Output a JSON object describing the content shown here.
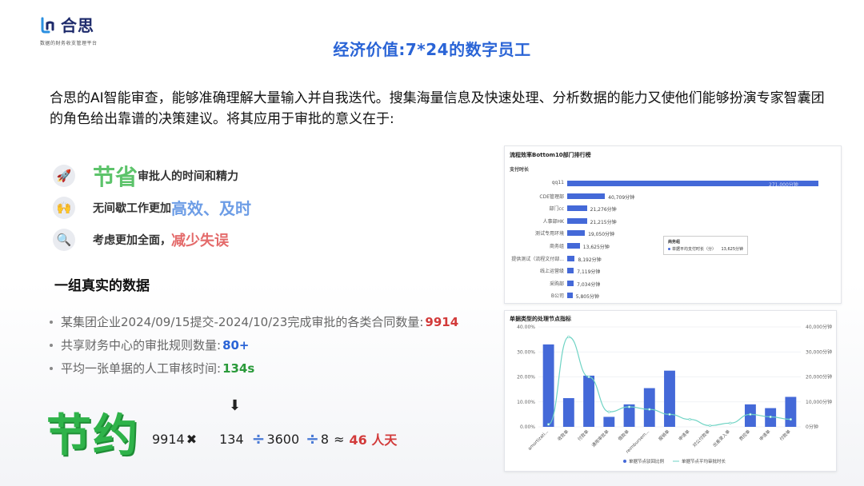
{
  "logo": {
    "name": "合思",
    "tagline": "数据的财务收支管理平台"
  },
  "title": "经济价值:7*24的数字员工",
  "intro": "合思的AI智能审查，能够准确理解大量输入并自我迭代。搜集海量信息及快速处理、分析数据的能力又使他们能够扮演专家智囊团的角色给出靠谱的决策建议。将其应用于审批的意义在于:",
  "points": [
    {
      "icon": "rocket-icon",
      "glyph": "🚀",
      "emph": "节省",
      "text": "审批人的时间和精力"
    },
    {
      "icon": "hands-icon",
      "glyph": "🙌",
      "text": "无间歇工作更加",
      "emph": "高效、及时"
    },
    {
      "icon": "magnifier-icon",
      "glyph": "🔍",
      "text": "考虑更加全面，",
      "emph": "减少失误"
    }
  ],
  "data_heading": "一组真实的数据",
  "facts": [
    {
      "text": "某集团企业2024/09/15提交-2024/10/23完成审批的各类合同数量:",
      "value": "9914"
    },
    {
      "text": "共享财务中心的审批规则数量:",
      "value": "80+"
    },
    {
      "text": "平均一张单据的人工审核时间:",
      "value": "134s"
    }
  ],
  "save_word": "节约",
  "formula": {
    "a": "9914",
    "times": "✖",
    "b": "134",
    "div1": "÷",
    "c": "3600",
    "div2": "÷",
    "d": "8",
    "approx": "≈",
    "result": "46 人天"
  },
  "arrow": "⬇",
  "colors": {
    "accent": "#2a64d6",
    "bar": "#4469d8",
    "green": "#2fb34a",
    "red": "#d23a3a"
  },
  "chart_data": [
    {
      "type": "bar",
      "title": "流程效率Bottom10部门排行榜",
      "subtitle": "支付时长",
      "categories": [
        "qq11",
        "CDE管理部",
        "部门cc",
        "人事部HK",
        "测试专用环境",
        "商务组",
        "提供测试（流程文付部...",
        "线上运营级",
        "采购部",
        "B公司"
      ],
      "values": [
        271000,
        40709,
        21276,
        21215,
        19050,
        13625,
        8192,
        7119,
        7034,
        5805
      ],
      "value_labels": [
        "271,000分钟",
        "40,709分钟",
        "21,276分钟",
        "21,215分钟",
        "19,050分钟",
        "13,625分钟",
        "8,192分钟",
        "7,119分钟",
        "7,034分钟",
        "5,805分钟"
      ],
      "tooltip": {
        "title": "商务组",
        "label": "单据平均支付时长（分）",
        "value": "13,625分钟"
      }
    },
    {
      "type": "bar",
      "title": "单据类型的处理节点指标",
      "categories": [
        "amortizati...",
        "收款单",
        "付款单",
        "通用审批单",
        "借款单",
        "reimbursem...",
        "报销单",
        "申请单",
        "对公付款单",
        "出差录入单",
        "费控单",
        "申请单",
        "付款单"
      ],
      "series": [
        {
          "name": "单据节点驳回比例",
          "values": [
            33,
            11.5,
            20.5,
            4,
            9,
            15.5,
            22.5,
            0,
            0,
            0,
            9,
            7.5,
            12
          ]
        },
        {
          "name": "单据节点平均审批时长",
          "values": [
            1000,
            36000,
            20000,
            6000,
            8000,
            7000,
            5000,
            3000,
            500,
            1500,
            5000,
            4000,
            3000
          ]
        }
      ],
      "y_left_ticks": [
        "0.00%",
        "10.00%",
        "20.00%",
        "30.00%",
        "40.00%"
      ],
      "y_right_ticks": [
        "0分钟",
        "10,000分钟",
        "20,000分钟",
        "30,000分钟",
        "40,000分钟"
      ],
      "ylim_left": [
        0,
        40
      ],
      "ylim_right": [
        0,
        40000
      ]
    }
  ]
}
